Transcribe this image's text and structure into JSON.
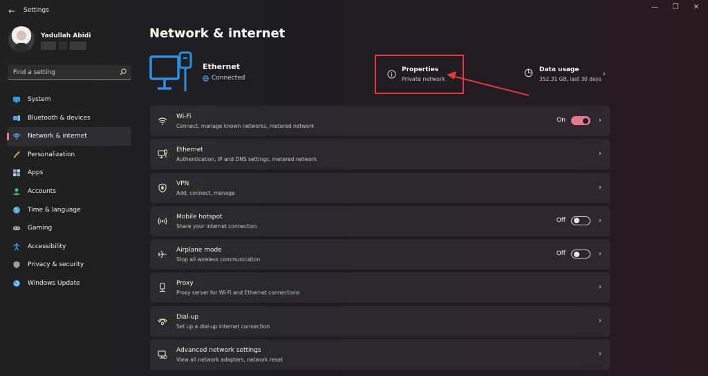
{
  "window": {
    "title": "Settings",
    "back_glyph": "←",
    "controls": {
      "minimize": "—",
      "maximize": "❐",
      "close": "✕"
    }
  },
  "profile": {
    "name": "Yadullah Abidi"
  },
  "search": {
    "placeholder": "Find a setting",
    "icon": "search-icon"
  },
  "sidebar": {
    "items": [
      {
        "label": "System",
        "icon": "system-icon",
        "active": false,
        "color": "#2d9cdb"
      },
      {
        "label": "Bluetooth & devices",
        "icon": "bluetooth-icon",
        "active": false,
        "color": "#4ba3e8"
      },
      {
        "label": "Network & internet",
        "icon": "network-icon",
        "active": true,
        "color": "#62b5f0"
      },
      {
        "label": "Personalization",
        "icon": "brush-icon",
        "active": false,
        "color": "#e2a255"
      },
      {
        "label": "Apps",
        "icon": "apps-icon",
        "active": false,
        "color": "#8fa7c4"
      },
      {
        "label": "Accounts",
        "icon": "accounts-icon",
        "active": false,
        "color": "#3fbf8f"
      },
      {
        "label": "Time & language",
        "icon": "globe-clock-icon",
        "active": false,
        "color": "#4aa8e2"
      },
      {
        "label": "Gaming",
        "icon": "gamepad-icon",
        "active": false,
        "color": "#b5b5b5"
      },
      {
        "label": "Accessibility",
        "icon": "accessibility-icon",
        "active": false,
        "color": "#3f95e6"
      },
      {
        "label": "Privacy & security",
        "icon": "shield-icon",
        "active": false,
        "color": "#9c9c9c"
      },
      {
        "label": "Windows Update",
        "icon": "update-icon",
        "active": false,
        "color": "#2b8ef0"
      }
    ]
  },
  "main": {
    "title": "Network & internet",
    "hero": {
      "title": "Ethernet",
      "status": "Connected"
    },
    "properties": {
      "title": "Properties",
      "subtitle": "Private network"
    },
    "data_usage": {
      "title": "Data usage",
      "subtitle": "352.31 GB, last 30 days"
    },
    "rows": [
      {
        "title": "Wi-Fi",
        "subtitle": "Connect, manage known networks, metered network",
        "icon": "wifi-icon",
        "toggle": "on",
        "toggle_label": "On"
      },
      {
        "title": "Ethernet",
        "subtitle": "Authentication, IP and DNS settings, metered network",
        "icon": "ethernet-icon"
      },
      {
        "title": "VPN",
        "subtitle": "Add, connect, manage",
        "icon": "vpn-shield-icon"
      },
      {
        "title": "Mobile hotspot",
        "subtitle": "Share your internet connection",
        "icon": "hotspot-icon",
        "toggle": "off",
        "toggle_label": "Off"
      },
      {
        "title": "Airplane mode",
        "subtitle": "Stop all wireless communication",
        "icon": "airplane-icon",
        "toggle": "off",
        "toggle_label": "Off"
      },
      {
        "title": "Proxy",
        "subtitle": "Proxy server for Wi-Fi and Ethernet connections",
        "icon": "proxy-icon"
      },
      {
        "title": "Dial-up",
        "subtitle": "Set up a dial-up internet connection",
        "icon": "dialup-icon"
      },
      {
        "title": "Advanced network settings",
        "subtitle": "View all network adapters, network reset",
        "icon": "advanced-network-icon"
      }
    ]
  },
  "colors": {
    "accent": "#e07a8e",
    "annotation": "#e23a3a",
    "hero_icon": "#2f8fe0"
  }
}
